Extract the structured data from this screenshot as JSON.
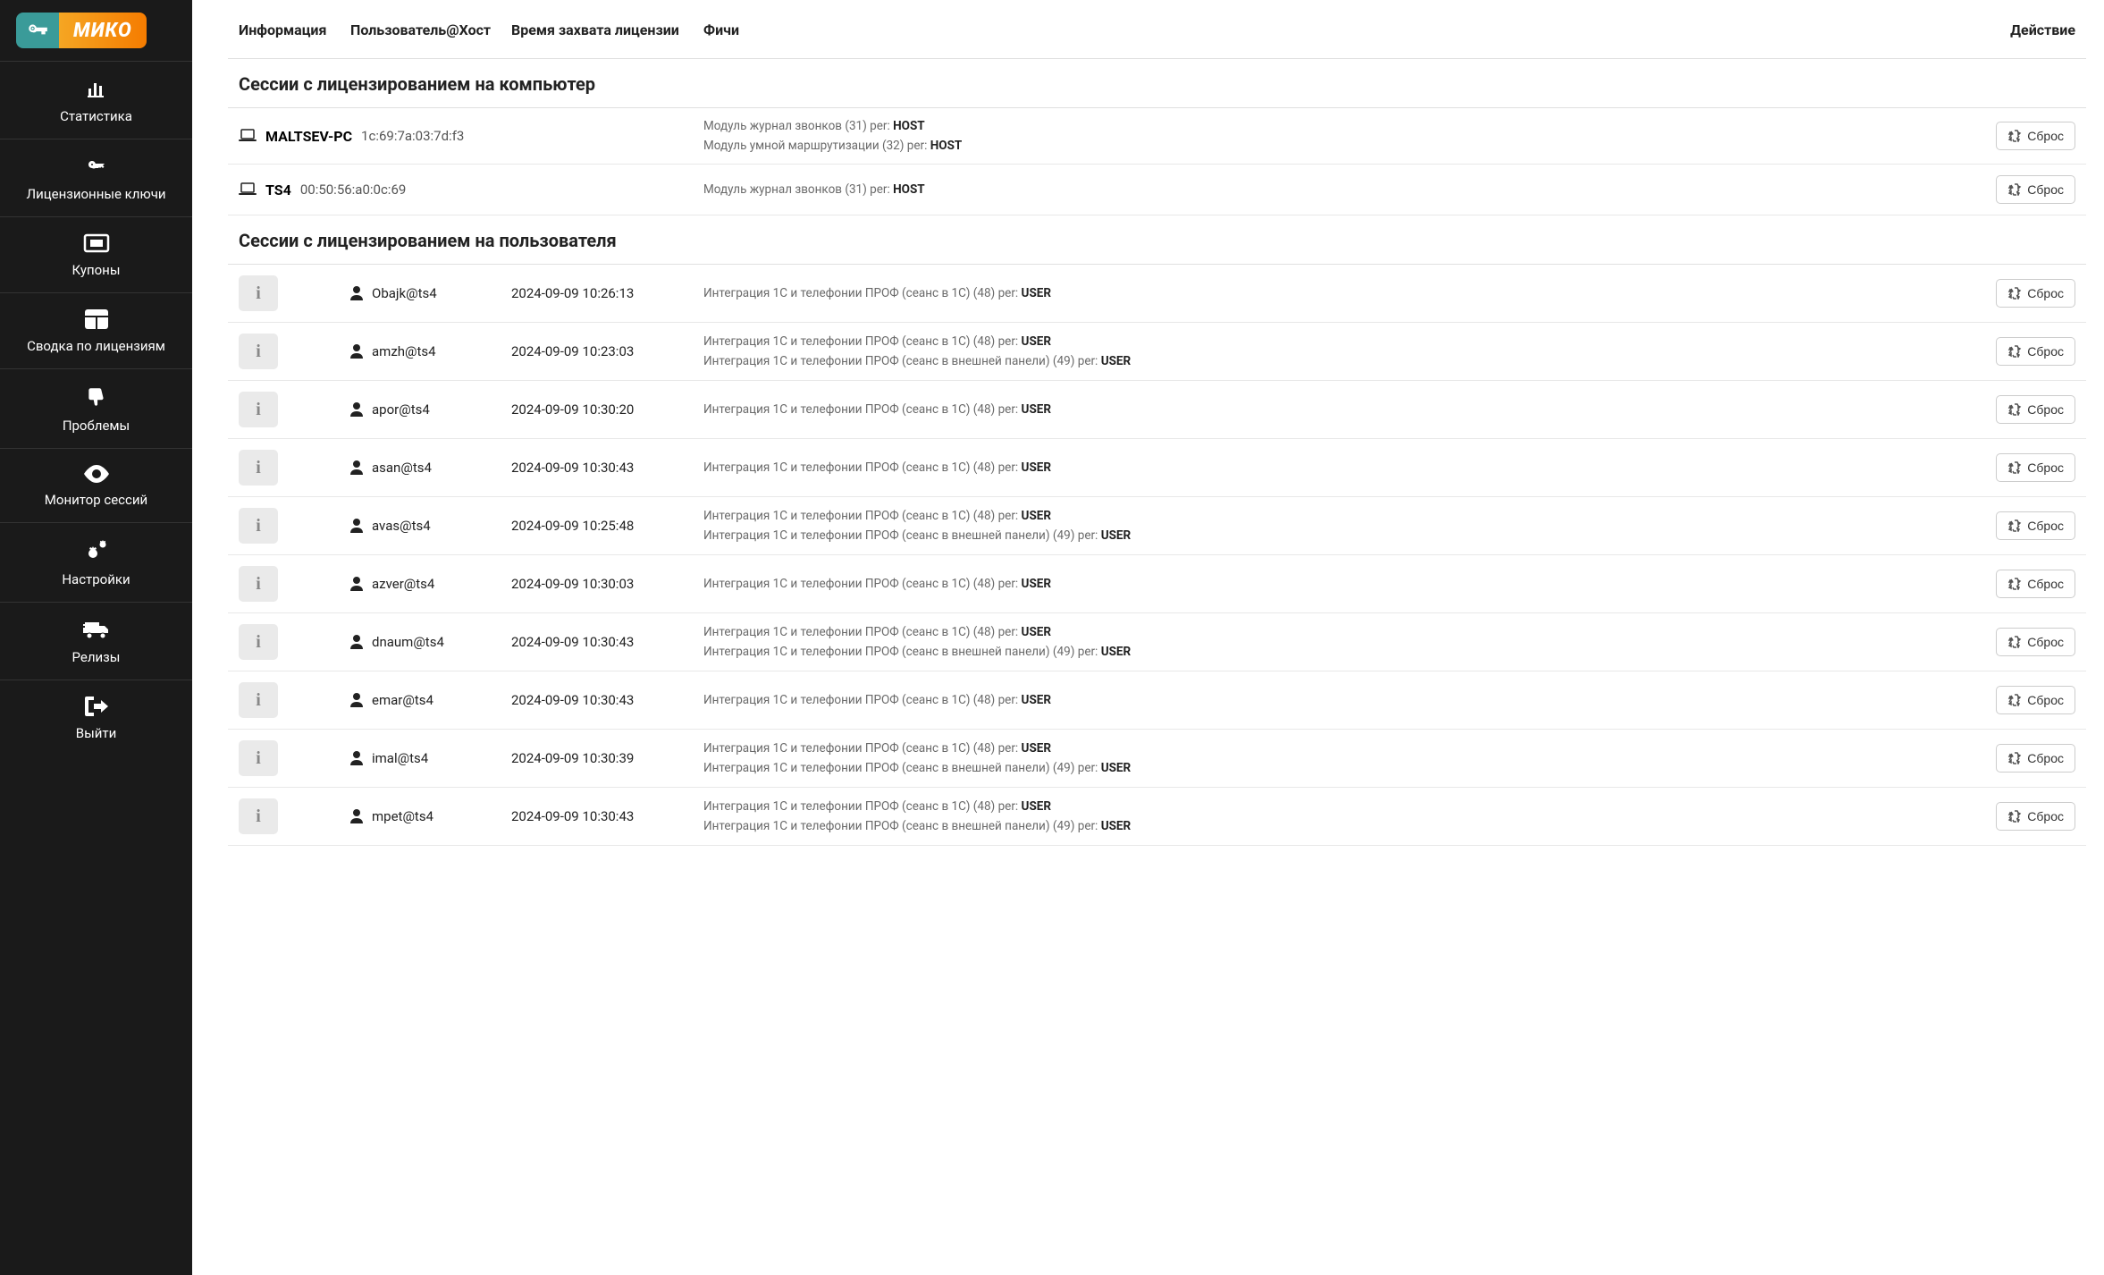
{
  "logo": {
    "text": "МИКО"
  },
  "nav": [
    {
      "label": "Статистика",
      "icon": "chart"
    },
    {
      "label": "Лицензионные ключи",
      "icon": "key"
    },
    {
      "label": "Купоны",
      "icon": "ticket"
    },
    {
      "label": "Сводка по лицензиям",
      "icon": "grid"
    },
    {
      "label": "Проблемы",
      "icon": "thumbdown"
    },
    {
      "label": "Монитор сессий",
      "icon": "eye"
    },
    {
      "label": "Настройки",
      "icon": "cogs"
    },
    {
      "label": "Релизы",
      "icon": "truck"
    },
    {
      "label": "Выйти",
      "icon": "logout"
    }
  ],
  "headers": {
    "info": "Информация",
    "user": "Пользователь@Хост",
    "time": "Время захвата лицензии",
    "feat": "Фичи",
    "act": "Действие"
  },
  "sections": {
    "host_title": "Сессии с лицензированием на компьютер",
    "user_title": "Сессии с лицензированием на пользователя"
  },
  "reset_label": "Сброс",
  "host_sessions": [
    {
      "name": "MALTSEV-PC",
      "mac": "1c:69:7a:03:7d:f3",
      "features": [
        {
          "text": "Модуль журнал звонков (31) per: ",
          "per": "HOST"
        },
        {
          "text": "Модуль умной маршрутизации (32) per: ",
          "per": "HOST"
        }
      ]
    },
    {
      "name": "TS4",
      "mac": "00:50:56:a0:0c:69",
      "features": [
        {
          "text": "Модуль журнал звонков (31) per: ",
          "per": "HOST"
        }
      ]
    }
  ],
  "user_sessions": [
    {
      "user": "Obajk@ts4",
      "time": "2024-09-09 10:26:13",
      "features": [
        {
          "text": "Интеграция 1С и телефонии ПРОФ (сеанс в 1С) (48) per: ",
          "per": "USER"
        }
      ]
    },
    {
      "user": "amzh@ts4",
      "time": "2024-09-09 10:23:03",
      "features": [
        {
          "text": "Интеграция 1С и телефонии ПРОФ (сеанс в 1С) (48) per: ",
          "per": "USER"
        },
        {
          "text": "Интеграция 1С и телефонии ПРОФ (сеанс в внешней панели) (49) per: ",
          "per": "USER"
        }
      ]
    },
    {
      "user": "apor@ts4",
      "time": "2024-09-09 10:30:20",
      "features": [
        {
          "text": "Интеграция 1С и телефонии ПРОФ (сеанс в 1С) (48) per: ",
          "per": "USER"
        }
      ]
    },
    {
      "user": "asan@ts4",
      "time": "2024-09-09 10:30:43",
      "features": [
        {
          "text": "Интеграция 1С и телефонии ПРОФ (сеанс в 1С) (48) per: ",
          "per": "USER"
        }
      ]
    },
    {
      "user": "avas@ts4",
      "time": "2024-09-09 10:25:48",
      "features": [
        {
          "text": "Интеграция 1С и телефонии ПРОФ (сеанс в 1С) (48) per: ",
          "per": "USER"
        },
        {
          "text": "Интеграция 1С и телефонии ПРОФ (сеанс в внешней панели) (49) per: ",
          "per": "USER"
        }
      ]
    },
    {
      "user": "azver@ts4",
      "time": "2024-09-09 10:30:03",
      "features": [
        {
          "text": "Интеграция 1С и телефонии ПРОФ (сеанс в 1С) (48) per: ",
          "per": "USER"
        }
      ]
    },
    {
      "user": "dnaum@ts4",
      "time": "2024-09-09 10:30:43",
      "features": [
        {
          "text": "Интеграция 1С и телефонии ПРОФ (сеанс в 1С) (48) per: ",
          "per": "USER"
        },
        {
          "text": "Интеграция 1С и телефонии ПРОФ (сеанс в внешней панели) (49) per: ",
          "per": "USER"
        }
      ]
    },
    {
      "user": "emar@ts4",
      "time": "2024-09-09 10:30:43",
      "features": [
        {
          "text": "Интеграция 1С и телефонии ПРОФ (сеанс в 1С) (48) per: ",
          "per": "USER"
        }
      ]
    },
    {
      "user": "imal@ts4",
      "time": "2024-09-09 10:30:39",
      "features": [
        {
          "text": "Интеграция 1С и телефонии ПРОФ (сеанс в 1С) (48) per: ",
          "per": "USER"
        },
        {
          "text": "Интеграция 1С и телефонии ПРОФ (сеанс в внешней панели) (49) per: ",
          "per": "USER"
        }
      ]
    },
    {
      "user": "mpet@ts4",
      "time": "2024-09-09 10:30:43",
      "features": [
        {
          "text": "Интеграция 1С и телефонии ПРОФ (сеанс в 1С) (48) per: ",
          "per": "USER"
        },
        {
          "text": "Интеграция 1С и телефонии ПРОФ (сеанс в внешней панели) (49) per: ",
          "per": "USER"
        }
      ]
    }
  ]
}
